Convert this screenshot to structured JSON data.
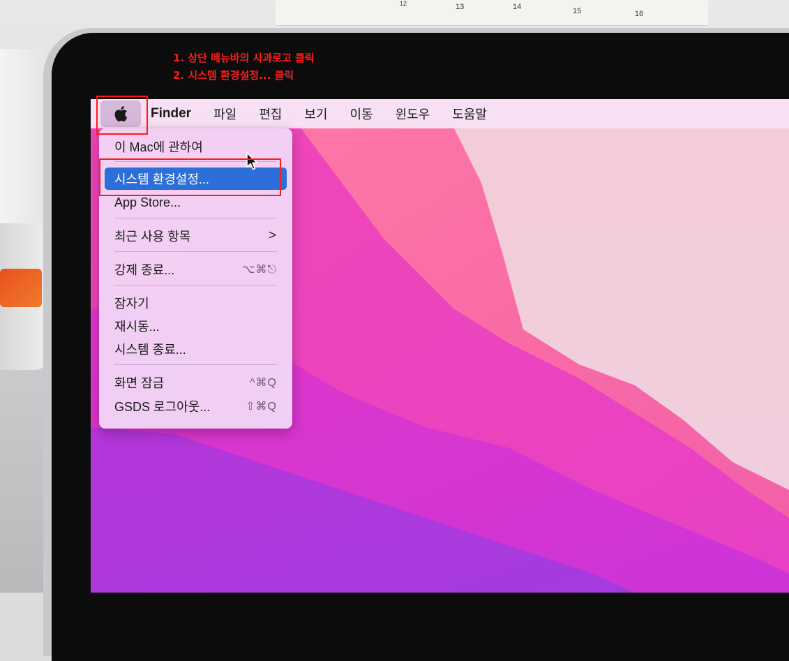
{
  "calendar": {
    "numbers": [
      "12",
      "13",
      "14",
      "15",
      "16"
    ]
  },
  "annotations": {
    "step1": "1. 상단 메뉴바의 사과로고 클릭",
    "step2": "2. 시스템 환경설정... 클릭"
  },
  "menubar": {
    "apple_icon": "apple-logo-icon",
    "items": [
      "Finder",
      "파일",
      "편집",
      "보기",
      "이동",
      "윈도우",
      "도움말"
    ]
  },
  "apple_menu": {
    "items": [
      {
        "label": "이 Mac에 관하여",
        "shortcut": ""
      },
      {
        "label": "시스템 환경설정...",
        "shortcut": "",
        "highlighted": true
      },
      {
        "label": "App Store...",
        "shortcut": ""
      },
      {
        "label": "최근 사용 항목",
        "shortcut": ">"
      },
      {
        "label": "강제 종료...",
        "shortcut": "⌥⌘⎋"
      },
      {
        "label": "잠자기",
        "shortcut": ""
      },
      {
        "label": "재시동...",
        "shortcut": ""
      },
      {
        "label": "시스템 종료...",
        "shortcut": ""
      },
      {
        "label": "화면 잠금",
        "shortcut": "^⌘Q"
      },
      {
        "label": "GSDS 로그아웃...",
        "shortcut": "⇧⌘Q"
      }
    ]
  },
  "colors": {
    "highlight": "#2c6fd8",
    "annotation": "#ff1a1a"
  }
}
